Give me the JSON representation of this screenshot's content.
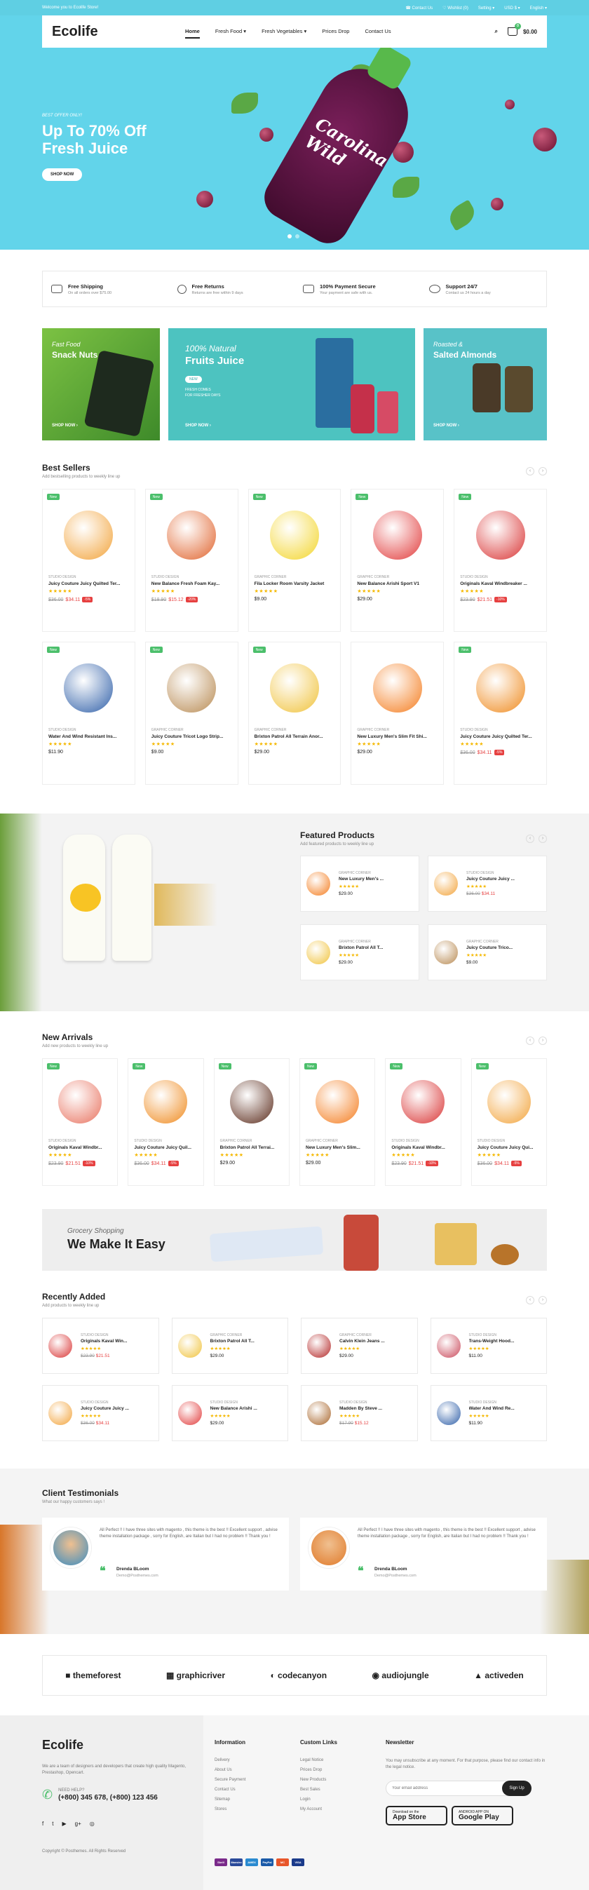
{
  "topbar": {
    "welcome": "Welcome you to Ecolife Store!",
    "contact": "Contact Us",
    "wishlist": "Wishlist (0)",
    "setting": "Setting",
    "currency": "USD $",
    "language": "English"
  },
  "header": {
    "logo": "Ecolife",
    "nav": [
      "Home",
      "Fresh Food",
      "Fresh Vegetables",
      "Prices Drop",
      "Contact Us"
    ],
    "cart_total": "$0.00",
    "cart_count": "0"
  },
  "hero": {
    "offer": "BEST OFFER ONLY!",
    "title_line1": "Up To 70% Off",
    "title_line2": "Fresh Juice",
    "button": "SHOP NOW",
    "bottle_label": "Carolina Wild"
  },
  "features": [
    {
      "title": "Free Shipping",
      "sub": "On all orders over $75.00"
    },
    {
      "title": "Free Returns",
      "sub": "Returns are free within 9 days"
    },
    {
      "title": "100% Payment Secure",
      "sub": "Your payment are safe with us."
    },
    {
      "title": "Support 24/7",
      "sub": "Contact us 24 hours a day"
    }
  ],
  "banners": [
    {
      "t1": "Fast Food",
      "t2": "Snack Nuts",
      "shop": "SHOP NOW"
    },
    {
      "t1": "100% Natural",
      "t2": "Fruits Juice",
      "new": "NEW",
      "copy": "FRESH COMES\nFOR FRESHER DAYS",
      "shop": "SHOP NOW"
    },
    {
      "t1": "Roasted &",
      "t2": "Salted Almonds",
      "shop": "SHOP NOW"
    }
  ],
  "best_sellers": {
    "title": "Best Sellers",
    "sub": "Add bestselling products to weekly line up",
    "products": [
      {
        "badge": "New",
        "vendor": "STUDIO DESIGN",
        "name": "Juicy Couture Juicy Quilted Ter...",
        "stars": "★★★★★",
        "old": "$36.00",
        "price": "$34.11",
        "off": "-5%",
        "color": "#f2a33a"
      },
      {
        "badge": "New",
        "vendor": "STUDIO DESIGN",
        "name": "New Balance Fresh Foam Kay...",
        "stars": "★★★★★",
        "old": "$18.90",
        "price": "$15.12",
        "off": "-20%",
        "color": "#e0632d"
      },
      {
        "badge": "New",
        "vendor": "GRAPHIC CORNER",
        "name": "Fila Locker Room Varsity Jacket",
        "stars": "★★★★★",
        "old": "",
        "price": "$9.00",
        "off": "",
        "color": "#f3d52a"
      },
      {
        "badge": "New",
        "vendor": "GRAPHIC CORNER",
        "name": "New Balance Arishi Sport V1",
        "stars": "★★★★★",
        "old": "",
        "price": "$29.00",
        "off": "",
        "color": "#e13a3a"
      },
      {
        "badge": "New",
        "vendor": "STUDIO DESIGN",
        "name": "Originals Kaval Windbreaker ...",
        "stars": "★★★★★",
        "old": "$23.90",
        "price": "$21.51",
        "off": "-10%",
        "color": "#d93434"
      },
      {
        "badge": "New",
        "vendor": "STUDIO DESIGN",
        "name": "Water And Wind Resistant Ins...",
        "stars": "★★★★★",
        "old": "",
        "price": "$11.90",
        "off": "",
        "color": "#2f5fa8"
      },
      {
        "badge": "New",
        "vendor": "GRAPHIC CORNER",
        "name": "Juicy Couture Tricot Logo Strip...",
        "stars": "★★★★★",
        "old": "",
        "price": "$9.00",
        "off": "",
        "color": "#b88a52"
      },
      {
        "badge": "New",
        "vendor": "GRAPHIC CORNER",
        "name": "Brixton Patrol All Terrain Anor...",
        "stars": "★★★★★",
        "old": "",
        "price": "$29.00",
        "off": "",
        "color": "#f0c23a"
      },
      {
        "badge": "",
        "vendor": "GRAPHIC CORNER",
        "name": "New Luxury Men's Slim Fit Shi...",
        "stars": "★★★★★",
        "old": "",
        "price": "$29.00",
        "off": "",
        "color": "#f47c1e"
      },
      {
        "badge": "New",
        "vendor": "STUDIO DESIGN",
        "name": "Juicy Couture Juicy Quilted Ter...",
        "stars": "★★★★★",
        "old": "$36.00",
        "price": "$34.11",
        "off": "-5%",
        "color": "#ef8a1e"
      }
    ]
  },
  "featured": {
    "title": "Featured Products",
    "sub": "Add featured products to weekly line up",
    "items": [
      {
        "vendor": "GRAPHIC CORNER",
        "name": "New Luxury Men's ...",
        "stars": "★★★★★",
        "old": "",
        "price": "$29.00",
        "color": "#f47c1e"
      },
      {
        "vendor": "STUDIO DESIGN",
        "name": "Juicy Couture Juicy ...",
        "stars": "★★★★★",
        "old": "$36.00",
        "price": "$34.11",
        "color": "#f2a33a"
      },
      {
        "vendor": "GRAPHIC CORNER",
        "name": "Brixton Patrol All T...",
        "stars": "★★★★★",
        "old": "",
        "price": "$29.00",
        "color": "#f0c23a"
      },
      {
        "vendor": "GRAPHIC CORNER",
        "name": "Juicy Couture Trico...",
        "stars": "★★★★★",
        "old": "",
        "price": "$9.00",
        "color": "#b88a52"
      }
    ]
  },
  "new_arrivals": {
    "title": "New Arrivals",
    "sub": "Add new products to weekly line up",
    "products": [
      {
        "badge": "New",
        "vendor": "STUDIO DESIGN",
        "name": "Originals Kaval Windbr...",
        "stars": "★★★★★",
        "old": "$23.90",
        "price": "$21.51",
        "off": "-10%",
        "color": "#e8725f"
      },
      {
        "badge": "New",
        "vendor": "STUDIO DESIGN",
        "name": "Juicy Couture Juicy Quil...",
        "stars": "★★★★★",
        "old": "$36.00",
        "price": "$34.11",
        "off": "-5%",
        "color": "#ef8a1e"
      },
      {
        "badge": "New",
        "vendor": "GRAPHIC CORNER",
        "name": "Brixton Patrol All Terrai...",
        "stars": "★★★★★",
        "old": "",
        "price": "$29.00",
        "off": "",
        "color": "#5a2a1a"
      },
      {
        "badge": "New",
        "vendor": "GRAPHIC CORNER",
        "name": "New Luxury Men's Slim...",
        "stars": "★★★★★",
        "old": "",
        "price": "$29.00",
        "off": "",
        "color": "#f47c1e"
      },
      {
        "badge": "New",
        "vendor": "STUDIO DESIGN",
        "name": "Originals Kaval Windbr...",
        "stars": "★★★★★",
        "old": "$23.90",
        "price": "$21.51",
        "off": "-10%",
        "color": "#d93434"
      },
      {
        "badge": "New",
        "vendor": "STUDIO DESIGN",
        "name": "Juicy Couture Juicy Qui...",
        "stars": "★★★★★",
        "old": "$36.00",
        "price": "$34.11",
        "off": "-5%",
        "color": "#f2a33a"
      }
    ]
  },
  "promo": {
    "s1": "Grocery Shopping",
    "s2": "We Make It Easy"
  },
  "recently_added": {
    "title": "Recently Added",
    "sub": "Add products to weekly line up",
    "items": [
      {
        "vendor": "STUDIO DESIGN",
        "name": "Originals Kaval Win...",
        "stars": "★★★★★",
        "old": "$23.90",
        "price": "$21.51",
        "color": "#d93434"
      },
      {
        "vendor": "GRAPHIC CORNER",
        "name": "Brixton Patrol All T...",
        "stars": "★★★★★",
        "old": "",
        "price": "$29.00",
        "color": "#f0c23a"
      },
      {
        "vendor": "GRAPHIC CORNER",
        "name": "Calvin Klein Jeans ...",
        "stars": "★★★★★",
        "old": "",
        "price": "$29.00",
        "color": "#b32626"
      },
      {
        "vendor": "STUDIO DESIGN",
        "name": "Trans-Weight Hood...",
        "stars": "★★★★★",
        "old": "",
        "price": "$11.00",
        "color": "#c9485a"
      },
      {
        "vendor": "STUDIO DESIGN",
        "name": "Juicy Couture Juicy ...",
        "stars": "★★★★★",
        "old": "$36.00",
        "price": "$34.11",
        "color": "#f2a33a"
      },
      {
        "vendor": "STUDIO DESIGN",
        "name": "New Balance Arishi ...",
        "stars": "★★★★★",
        "old": "",
        "price": "$29.00",
        "color": "#e13a3a"
      },
      {
        "vendor": "STUDIO DESIGN",
        "name": "Madden By Steve ...",
        "stars": "★★★★★",
        "old": "$17.90",
        "price": "$15.12",
        "color": "#a8652a"
      },
      {
        "vendor": "STUDIO DESIGN",
        "name": "Water And Wind Re...",
        "stars": "★★★★★",
        "old": "",
        "price": "$11.90",
        "color": "#2f5fa8"
      }
    ]
  },
  "testimonials": {
    "title": "Client Testimonials",
    "sub": "What our happy customers says !",
    "items": [
      {
        "quote": "All Perfect !! I have three sites with magento , this theme is the best !! Excellent support , advise theme installation package , sorry for English, are Italian but I had no problem !! Thank you !",
        "name": "Drenda BLoom",
        "email": "Demo@Posthemes.com"
      },
      {
        "quote": "All Perfect !! I have three sites with magento , this theme is the best !! Excellent support , advise theme installation package , sorry for English, are Italian but I had no problem !! Thank you !",
        "name": "Drenda BLoom",
        "email": "Demo@Posthemes.com"
      }
    ]
  },
  "brands": [
    "themeforest",
    "graphicriver",
    "codecanyon",
    "audiojungle",
    "activeden"
  ],
  "footer": {
    "logo": "Ecolife",
    "about": "We are a team of designers and developers that create high quality Magento, Prestashop, Opencart.",
    "help_label": "NEED HELP?",
    "phone": "(+800) 345 678, (+800) 123 456",
    "info_title": "Information",
    "info": [
      "Delivery",
      "About Us",
      "Secure Payment",
      "Contact Us",
      "Sitemap",
      "Stores"
    ],
    "links_title": "Custom Links",
    "links": [
      "Legal Notice",
      "Prices Drop",
      "New Products",
      "Best Sales",
      "Login",
      "My Account"
    ],
    "news_title": "Newsletter",
    "news_text": "You may unsubscribe at any moment. For that purpose, please find our contact info in the legal notice.",
    "email_placeholder": "Your email address",
    "sign_up": "Sign Up",
    "app1_small": "Download on the",
    "app1": "App Store",
    "app2_small": "ANDROID APP ON",
    "app2": "Google Play",
    "copyright": "Copyright © Posthemes. All Rights Reserved",
    "payments": [
      "Skrill",
      "Maestro",
      "AMEX",
      "PayPal",
      "MC",
      "VISA"
    ]
  }
}
